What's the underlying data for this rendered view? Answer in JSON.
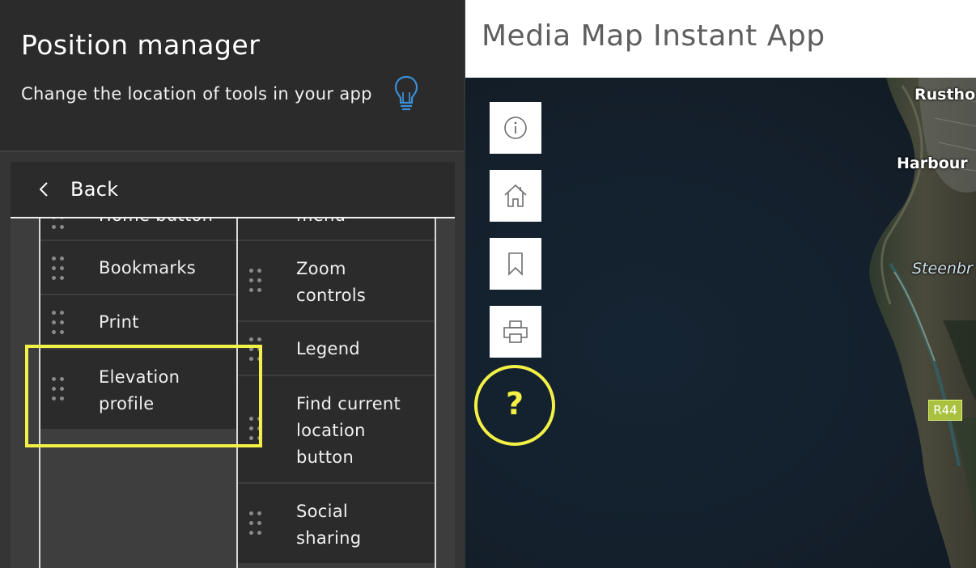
{
  "panel": {
    "title": "Position manager",
    "subtitle": "Change the location of tools in your app",
    "tip_icon": "lightbulb-icon",
    "back_label": "Back"
  },
  "column_a": {
    "items": [
      {
        "label_line1": "Home button",
        "label_line2": ""
      },
      {
        "label_line1": "Bookmarks",
        "label_line2": ""
      },
      {
        "label_line1": "Print",
        "label_line2": ""
      },
      {
        "label_line1": "Elevation",
        "label_line2": "profile"
      }
    ]
  },
  "column_b": {
    "items": [
      {
        "label_line1": "menu",
        "label_line2": ""
      },
      {
        "label_line1": "Zoom",
        "label_line2": "controls"
      },
      {
        "label_line1": "Legend",
        "label_line2": ""
      },
      {
        "label_line1": "Find current",
        "label_line2": "location",
        "label_line3": "button"
      },
      {
        "label_line1": "Social",
        "label_line2": "sharing"
      }
    ]
  },
  "app": {
    "title": "Media Map Instant App"
  },
  "map": {
    "buttons": [
      {
        "name": "info-icon"
      },
      {
        "name": "home-icon"
      },
      {
        "name": "bookmark-icon"
      },
      {
        "name": "print-icon"
      }
    ],
    "help_mark": "?",
    "labels": {
      "rustho": "Rustho",
      "harbour": "Harbour",
      "steenbr": "Steenbr"
    },
    "road_badge": "R44"
  },
  "colors": {
    "highlight": "#f3f046",
    "tip_icon": "#3b8fd8",
    "panel_bg": "#2b2b2b"
  }
}
